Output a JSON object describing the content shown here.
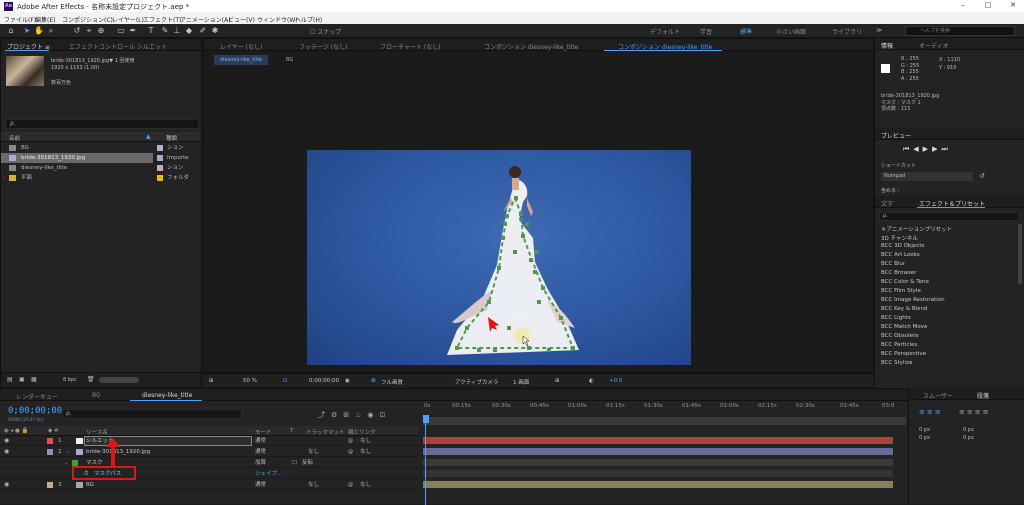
{
  "window": {
    "title": "Adobe After Effects - 名称未設定プロジェクト.aep *",
    "app_icon": "Ae",
    "min": "–",
    "max": "□",
    "close": "✕"
  },
  "menu": [
    "ファイル(F)",
    "編集(E)",
    "コンポジション(C)",
    "レイヤー(L)",
    "エフェクト(T)",
    "アニメーション(A)",
    "ビュー(V)",
    "ウィンドウ(W)",
    "ヘルプ(H)"
  ],
  "toolbar": {
    "snap_label": "スナップ",
    "workspaces": [
      "デフォルト",
      "学習",
      "標準",
      "小さい画面",
      "ライブラリ"
    ],
    "active_workspace": "標準",
    "help_search_placeholder": "ヘルプを検索"
  },
  "project_panel": {
    "tab_project": "プロジェクト ≡",
    "tab_effect_controls": "エフェクトコントロール シルエット",
    "file_name": "bride-301813_1920.jpg▼",
    "usage": "1 回使用",
    "dimensions": "1920 x 1153 (1.00)",
    "colors": "数百万色",
    "search_placeholder": "ρ.",
    "col_name": "名前",
    "col_type": "種類",
    "items": [
      {
        "name": "BG",
        "type": "ション",
        "color": "#c8a8c8"
      },
      {
        "name": "bride-301813_1920.jpg",
        "type": "Importe",
        "color": "#a8a8d0"
      },
      {
        "name": "diesney-like_title",
        "type": "ション",
        "color": "#c8a8c8"
      },
      {
        "name": "平面",
        "type": "フォルダ",
        "color": "#e0c000"
      }
    ],
    "bpc": "8 bpc"
  },
  "viewer": {
    "tabs": [
      "レイヤー (なし)",
      "フッテージ (なし)",
      "フローチャート (なし)",
      "コンポジション diesney-like_title",
      "コンポジション diesney-like_title"
    ],
    "sub_tabs": [
      "diesney-like_title",
      "BG"
    ],
    "zoom": "50 %",
    "timecode": "0;00;00;00",
    "quality": "フル画質",
    "camera": "アクティブカメラ",
    "views": "1 画面",
    "exposure": "+0.0"
  },
  "info_panel": {
    "tab_info": "情報",
    "tab_audio": "オーディオ",
    "r": "R : 255",
    "g": "G : 255",
    "b": "B : 255",
    "a": "A : 255",
    "x": "X : 1110",
    "y": "Y : 910",
    "file_line": "bride-301813_1920.jpg",
    "mask_line": "マスク : マスク 1",
    "vertex_line": "頂点数 : 115"
  },
  "preview_panel": {
    "tab": "プレビュー",
    "shortcut_label": "ショートカット",
    "shortcut_value": "Numpad",
    "include_label": "含める :"
  },
  "effects_panel": {
    "tab_text": "文字",
    "tab_effects": "エフェクト＆プリセット",
    "search_placeholder": "ρ.",
    "items": [
      "＊アニメーションプリセット",
      "3D チャンネル",
      "BCC 3D Objects",
      "BCC Art Looks",
      "BCC Blur",
      "BCC Browser",
      "BCC Color & Tone",
      "BCC Film Style",
      "BCC Image Restoration",
      "BCC Key & Blend",
      "BCC Lights",
      "BCC Match Move",
      "BCC Obsolete",
      "BCC Particles",
      "BCC Perspective",
      "BCC Stylize"
    ]
  },
  "timeline": {
    "tabs": [
      "レンダーキュー",
      "BG",
      "diesney-like_title"
    ],
    "timecode": "0;00;00;00",
    "timecode_sub": "00000 (29.97 fps)",
    "search_placeholder": "ρ.",
    "col_source": "ソース名",
    "col_mode": "モード",
    "col_t": "T",
    "col_trackmatte": "トラックマット",
    "col_parent": "親とリンク",
    "ruler": [
      "0s",
      "00:15s",
      "00:30s",
      "00:45s",
      "01:00s",
      "01:15s",
      "01:30s",
      "01:45s",
      "02:00s",
      "02:15s",
      "02:30s",
      "02:45s",
      "03:0"
    ],
    "layers": [
      {
        "num": "1",
        "name": "シルエット",
        "mode": "通常",
        "matte": "",
        "parent": "なし",
        "color": "#e05050"
      },
      {
        "num": "2",
        "name": "bride-301813_1920.jpg",
        "mode": "通常",
        "matte": "なし",
        "parent": "なし",
        "color": "#9090c0"
      },
      {
        "name": "マスク",
        "mode": "加算",
        "extra": "反転"
      },
      {
        "name": "マスクパス",
        "shape_label": "シェイプ..."
      },
      {
        "num": "3",
        "name": "BG",
        "mode": "通常",
        "matte": "なし",
        "parent": "なし",
        "color": "#c0b090"
      }
    ]
  },
  "paragraph_panel": {
    "tab_smoother": "スムーザー",
    "tab_paragraph": "段落",
    "px": "0 px"
  }
}
